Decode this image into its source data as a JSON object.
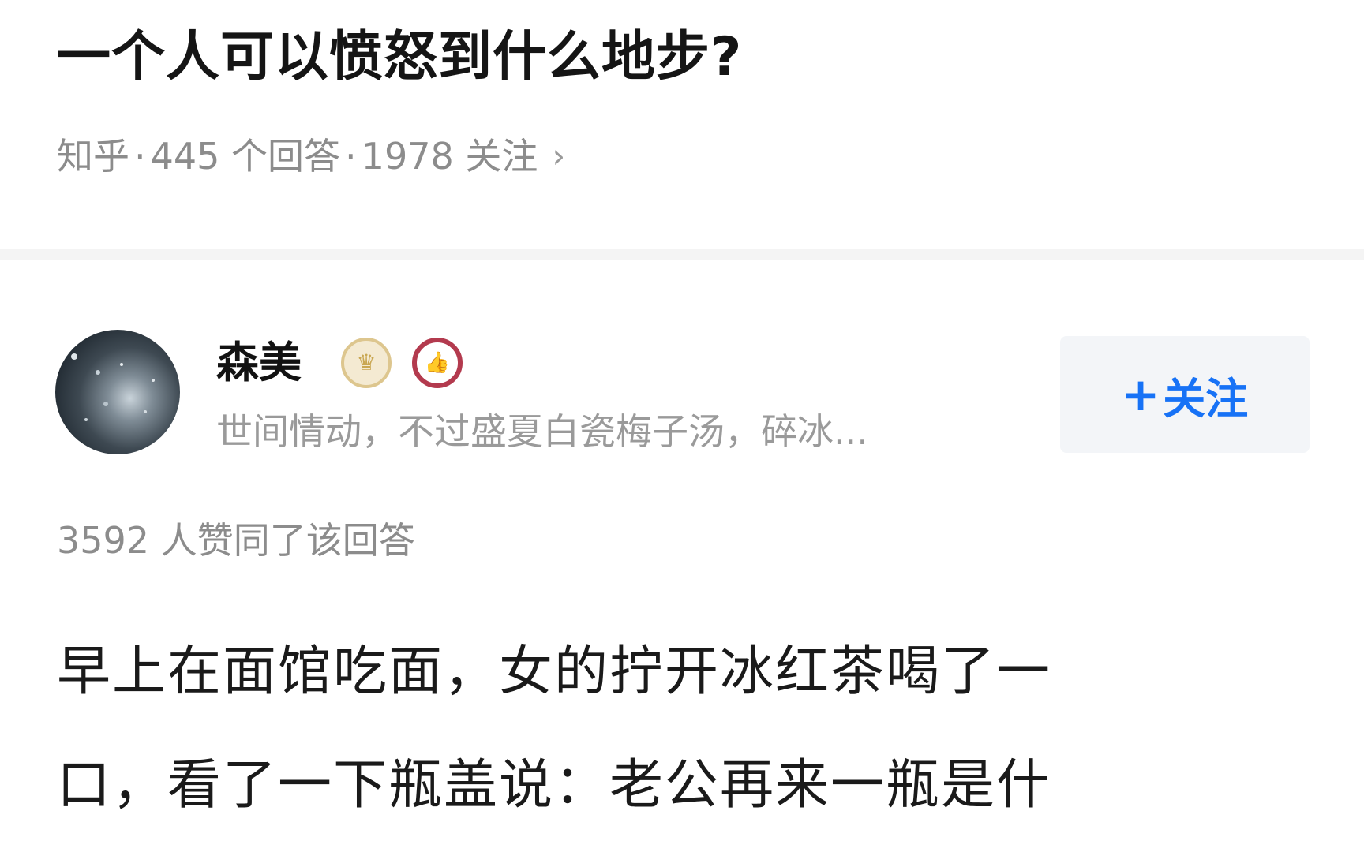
{
  "question": {
    "title": "一个人可以愤怒到什么地步?",
    "source": "知乎",
    "answer_count": "445 个回答",
    "follower_count": "1978 关注",
    "separator": "·"
  },
  "author": {
    "name": "森美",
    "bio": "世间情动，不过盛夏白瓷梅子汤，碎冰...",
    "follow_label": "关注",
    "follow_prefix": "+"
  },
  "answer": {
    "vote_text": "3592 人赞同了该回答",
    "lines": [
      "早上在面馆吃面，女的拧开冰红茶喝了一",
      "口，看了一下瓶盖说：老公再来一瓶是什"
    ]
  },
  "icons": {
    "chevron": "chevron-right-icon",
    "crown_badge": "crown-badge-icon",
    "like_badge": "thumbs-up-badge-icon",
    "plus": "plus-icon"
  },
  "colors": {
    "accent": "#1772f6",
    "meta_text": "#8c8c8c",
    "badge_gold": "#ddc68e",
    "badge_red": "#b33a4e"
  }
}
